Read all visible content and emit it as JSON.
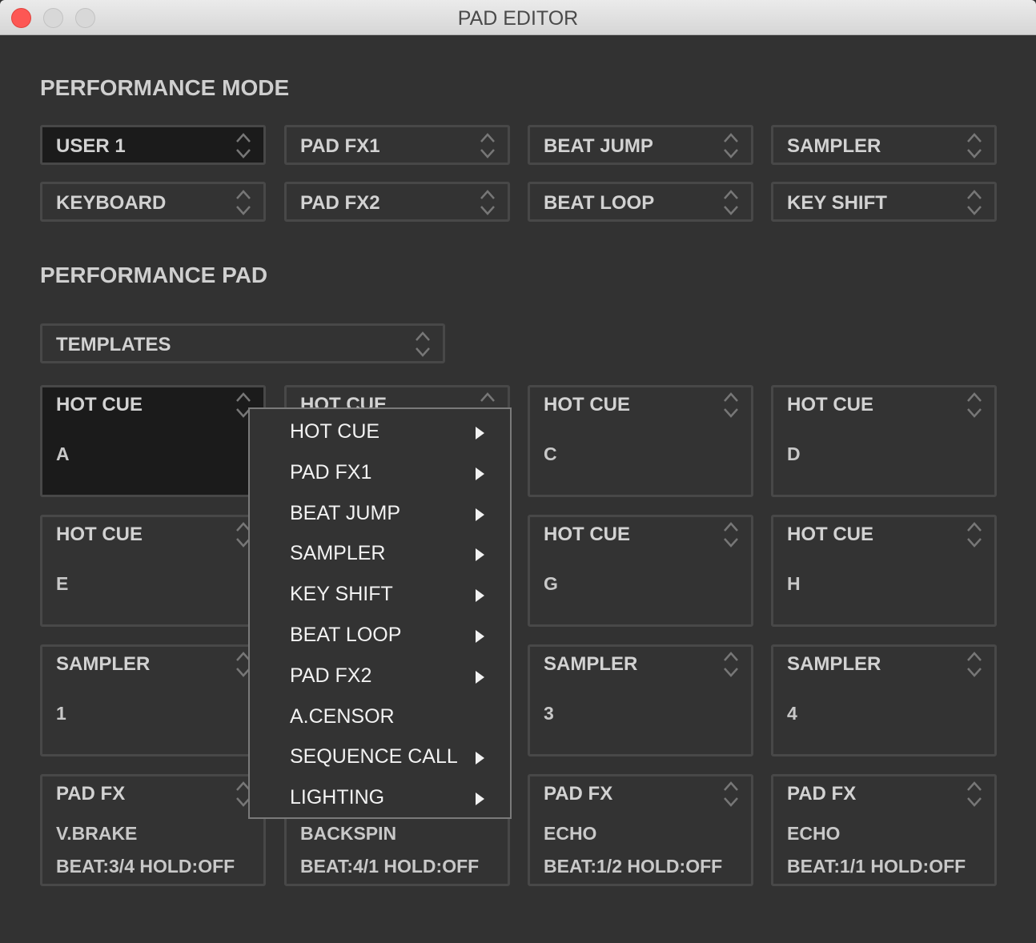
{
  "window": {
    "title": "PAD EDITOR"
  },
  "colors": {
    "background": "#323232",
    "selected_background": "#1b1b1b",
    "border": "#484848",
    "close": "#fd5754"
  },
  "performance_mode": {
    "heading": "PERFORMANCE MODE",
    "selects": [
      {
        "label": "USER 1",
        "selected": true
      },
      {
        "label": "PAD FX1"
      },
      {
        "label": "BEAT JUMP"
      },
      {
        "label": "SAMPLER"
      },
      {
        "label": "KEYBOARD"
      },
      {
        "label": "PAD FX2"
      },
      {
        "label": "BEAT LOOP"
      },
      {
        "label": "KEY SHIFT"
      }
    ]
  },
  "performance_pad": {
    "heading": "PERFORMANCE PAD",
    "templates_label": "TEMPLATES",
    "pads": [
      {
        "title": "HOT CUE",
        "line1": "A",
        "selected": true
      },
      {
        "title": "HOT CUE",
        "line1": ""
      },
      {
        "title": "HOT CUE",
        "line1": "C"
      },
      {
        "title": "HOT CUE",
        "line1": "D"
      },
      {
        "title": "HOT CUE",
        "line1": "E"
      },
      {
        "title": "",
        "line1": ""
      },
      {
        "title": "HOT CUE",
        "line1": "G"
      },
      {
        "title": "HOT CUE",
        "line1": "H"
      },
      {
        "title": "SAMPLER",
        "line1": "1"
      },
      {
        "title": "",
        "line1": ""
      },
      {
        "title": "SAMPLER",
        "line1": "3"
      },
      {
        "title": "SAMPLER",
        "line1": "4"
      },
      {
        "title": "PAD FX",
        "line1": "V.BRAKE",
        "line2": "BEAT:3/4 HOLD:OFF"
      },
      {
        "title": "",
        "line1": "BACKSPIN",
        "line2": "BEAT:4/1 HOLD:OFF"
      },
      {
        "title": "PAD FX",
        "line1": "ECHO",
        "line2": "BEAT:1/2 HOLD:OFF"
      },
      {
        "title": "PAD FX",
        "line1": "ECHO",
        "line2": "BEAT:1/1 HOLD:OFF"
      }
    ]
  },
  "context_menu": {
    "items": [
      {
        "label": "HOT CUE",
        "submenu": true
      },
      {
        "label": "PAD FX1",
        "submenu": true
      },
      {
        "label": "BEAT JUMP",
        "submenu": true
      },
      {
        "label": "SAMPLER",
        "submenu": true
      },
      {
        "label": "KEY SHIFT",
        "submenu": true
      },
      {
        "label": "BEAT LOOP",
        "submenu": true
      },
      {
        "label": "PAD FX2",
        "submenu": true
      },
      {
        "label": "A.CENSOR",
        "submenu": false
      },
      {
        "label": "SEQUENCE CALL",
        "submenu": true
      },
      {
        "label": "LIGHTING",
        "submenu": true
      }
    ]
  }
}
